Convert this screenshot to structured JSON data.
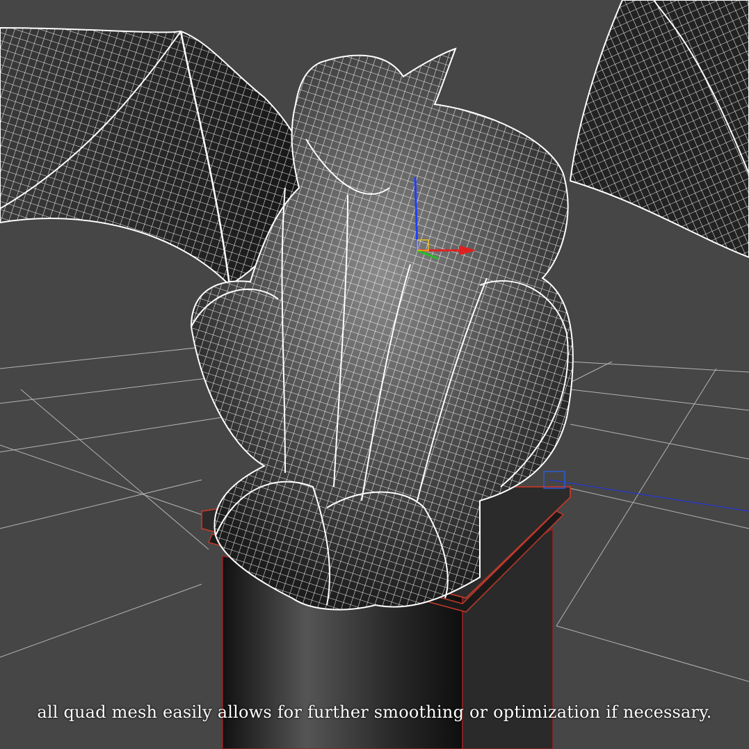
{
  "viewport": {
    "background_color": "#464646",
    "grid_color": "#c8c8c8",
    "wireframe_color": "#ffffff",
    "selection_outline_color": "#c0392b",
    "gizmo_axes": {
      "x_color": "#e02020",
      "y_color": "#20c020",
      "z_color": "#2040ff"
    },
    "subject": "gargoyle-on-pedestal"
  },
  "caption": {
    "text": "all quad mesh easily allows for further smoothing or optimization if necessary."
  }
}
